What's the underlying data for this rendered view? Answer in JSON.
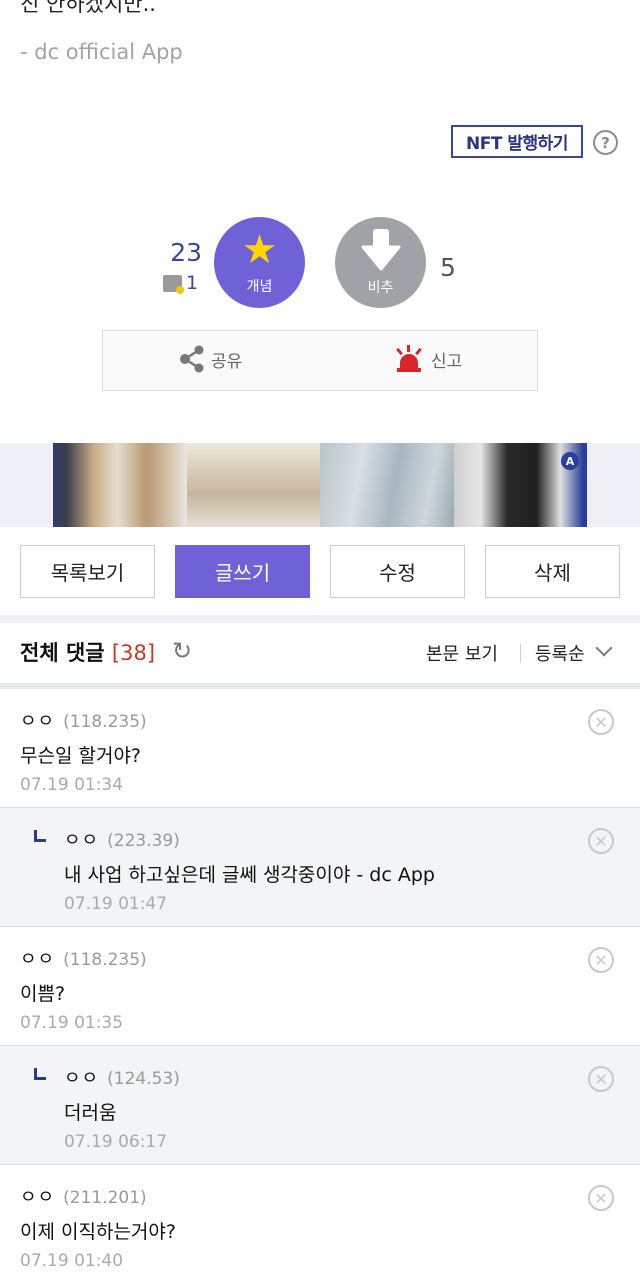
{
  "post": {
    "cut_text": "진 안하겠지만..",
    "signature": "- dc official App",
    "nft_button": "NFT 발행하기",
    "help_icon": "?"
  },
  "votes": {
    "up_count": "23",
    "up_fix_count": "1",
    "up_label": "개념",
    "down_label": "비추",
    "down_count": "5"
  },
  "actions": {
    "share": "공유",
    "report": "신고"
  },
  "buttons": {
    "list": "목록보기",
    "write": "글쓰기",
    "edit": "수정",
    "delete": "삭제"
  },
  "comments_header": {
    "title": "전체 댓글",
    "count": "[38]",
    "view_body": "본문 보기",
    "sort": "등록순"
  },
  "comments": [
    {
      "name": "ㅇㅇ",
      "ip": "(118.235)",
      "text": "무슨일 할거야?",
      "date": "07.19 01:34",
      "reply": false
    },
    {
      "name": "ㅇㅇ",
      "ip": "(223.39)",
      "text": "내 사업 하고싶은데 글쎄 생각중이야 - dc App",
      "date": "07.19 01:47",
      "reply": true
    },
    {
      "name": "ㅇㅇ",
      "ip": "(118.235)",
      "text": "이쁨?",
      "date": "07.19 01:35",
      "reply": false
    },
    {
      "name": "ㅇㅇ",
      "ip": "(124.53)",
      "text": "더러움",
      "date": "07.19 06:17",
      "reply": true
    },
    {
      "name": "ㅇㅇ",
      "ip": "(211.201)",
      "text": "이제 이직하는거야?",
      "date": "07.19 01:40",
      "reply": false
    }
  ],
  "ad": {
    "badge": "A"
  },
  "colors": {
    "accent": "#6e62d6",
    "navy": "#3b4890",
    "report_red": "#d8262a"
  }
}
